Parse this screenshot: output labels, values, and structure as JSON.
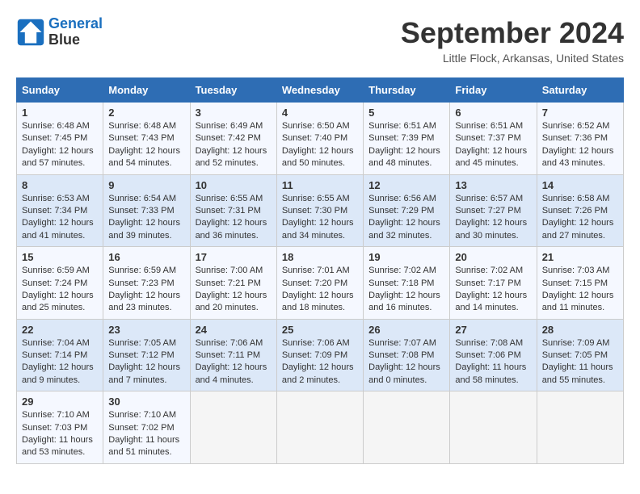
{
  "header": {
    "logo_line1": "General",
    "logo_line2": "Blue",
    "title": "September 2024",
    "location": "Little Flock, Arkansas, United States"
  },
  "calendar": {
    "days_of_week": [
      "Sunday",
      "Monday",
      "Tuesday",
      "Wednesday",
      "Thursday",
      "Friday",
      "Saturday"
    ],
    "weeks": [
      [
        null,
        null,
        {
          "day": "1",
          "sunrise": "6:48 AM",
          "sunset": "7:45 PM",
          "daylight": "12 hours and 57 minutes."
        },
        {
          "day": "2",
          "sunrise": "6:48 AM",
          "sunset": "7:43 PM",
          "daylight": "12 hours and 54 minutes."
        },
        {
          "day": "3",
          "sunrise": "6:49 AM",
          "sunset": "7:42 PM",
          "daylight": "12 hours and 52 minutes."
        },
        {
          "day": "4",
          "sunrise": "6:50 AM",
          "sunset": "7:40 PM",
          "daylight": "12 hours and 50 minutes."
        },
        {
          "day": "5",
          "sunrise": "6:51 AM",
          "sunset": "7:39 PM",
          "daylight": "12 hours and 48 minutes."
        },
        {
          "day": "6",
          "sunrise": "6:51 AM",
          "sunset": "7:37 PM",
          "daylight": "12 hours and 45 minutes."
        },
        {
          "day": "7",
          "sunrise": "6:52 AM",
          "sunset": "7:36 PM",
          "daylight": "12 hours and 43 minutes."
        }
      ],
      [
        {
          "day": "8",
          "sunrise": "6:53 AM",
          "sunset": "7:34 PM",
          "daylight": "12 hours and 41 minutes."
        },
        {
          "day": "9",
          "sunrise": "6:54 AM",
          "sunset": "7:33 PM",
          "daylight": "12 hours and 39 minutes."
        },
        {
          "day": "10",
          "sunrise": "6:55 AM",
          "sunset": "7:31 PM",
          "daylight": "12 hours and 36 minutes."
        },
        {
          "day": "11",
          "sunrise": "6:55 AM",
          "sunset": "7:30 PM",
          "daylight": "12 hours and 34 minutes."
        },
        {
          "day": "12",
          "sunrise": "6:56 AM",
          "sunset": "7:29 PM",
          "daylight": "12 hours and 32 minutes."
        },
        {
          "day": "13",
          "sunrise": "6:57 AM",
          "sunset": "7:27 PM",
          "daylight": "12 hours and 30 minutes."
        },
        {
          "day": "14",
          "sunrise": "6:58 AM",
          "sunset": "7:26 PM",
          "daylight": "12 hours and 27 minutes."
        }
      ],
      [
        {
          "day": "15",
          "sunrise": "6:59 AM",
          "sunset": "7:24 PM",
          "daylight": "12 hours and 25 minutes."
        },
        {
          "day": "16",
          "sunrise": "6:59 AM",
          "sunset": "7:23 PM",
          "daylight": "12 hours and 23 minutes."
        },
        {
          "day": "17",
          "sunrise": "7:00 AM",
          "sunset": "7:21 PM",
          "daylight": "12 hours and 20 minutes."
        },
        {
          "day": "18",
          "sunrise": "7:01 AM",
          "sunset": "7:20 PM",
          "daylight": "12 hours and 18 minutes."
        },
        {
          "day": "19",
          "sunrise": "7:02 AM",
          "sunset": "7:18 PM",
          "daylight": "12 hours and 16 minutes."
        },
        {
          "day": "20",
          "sunrise": "7:02 AM",
          "sunset": "7:17 PM",
          "daylight": "12 hours and 14 minutes."
        },
        {
          "day": "21",
          "sunrise": "7:03 AM",
          "sunset": "7:15 PM",
          "daylight": "12 hours and 11 minutes."
        }
      ],
      [
        {
          "day": "22",
          "sunrise": "7:04 AM",
          "sunset": "7:14 PM",
          "daylight": "12 hours and 9 minutes."
        },
        {
          "day": "23",
          "sunrise": "7:05 AM",
          "sunset": "7:12 PM",
          "daylight": "12 hours and 7 minutes."
        },
        {
          "day": "24",
          "sunrise": "7:06 AM",
          "sunset": "7:11 PM",
          "daylight": "12 hours and 4 minutes."
        },
        {
          "day": "25",
          "sunrise": "7:06 AM",
          "sunset": "7:09 PM",
          "daylight": "12 hours and 2 minutes."
        },
        {
          "day": "26",
          "sunrise": "7:07 AM",
          "sunset": "7:08 PM",
          "daylight": "12 hours and 0 minutes."
        },
        {
          "day": "27",
          "sunrise": "7:08 AM",
          "sunset": "7:06 PM",
          "daylight": "11 hours and 58 minutes."
        },
        {
          "day": "28",
          "sunrise": "7:09 AM",
          "sunset": "7:05 PM",
          "daylight": "11 hours and 55 minutes."
        }
      ],
      [
        {
          "day": "29",
          "sunrise": "7:10 AM",
          "sunset": "7:03 PM",
          "daylight": "11 hours and 53 minutes."
        },
        {
          "day": "30",
          "sunrise": "7:10 AM",
          "sunset": "7:02 PM",
          "daylight": "11 hours and 51 minutes."
        },
        null,
        null,
        null,
        null,
        null
      ]
    ]
  }
}
